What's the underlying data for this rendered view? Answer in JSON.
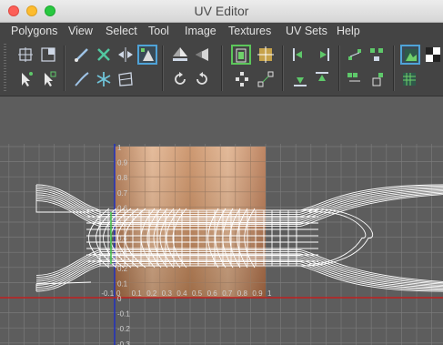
{
  "window": {
    "title": "UV Editor"
  },
  "menu": [
    "Polygons",
    "View",
    "Select",
    "Tool",
    "Image",
    "Textures",
    "UV Sets",
    "Help"
  ],
  "toolbar": {
    "row1": [
      "cut-uv-edges-icon",
      "sew-uv-edges-icon",
      "brush-icon",
      "move-sew-icon",
      "flip-icon",
      "layout-icon",
      "normalize-icon",
      "unfold-icon",
      "isolate-icon",
      "grid-snap-icon",
      "align-left-icon",
      "align-right-icon",
      "distribute-icon",
      "stack-icon",
      "texture-display-icon",
      "checker-icon"
    ],
    "row2": [
      "select-shell-icon",
      "select-border-icon",
      "smear-icon",
      "snowflake-icon",
      "relax-icon",
      "rotate-ccw-icon",
      "rotate-cw-icon",
      "pin-uv-icon",
      "distribute-uv-icon",
      "align-down-icon",
      "align-up-icon",
      "snap-together-icon",
      "shell-icon",
      "shaded-uv-icon"
    ]
  },
  "viewport": {
    "axis_labels_v": [
      "1",
      "0.9",
      "0.8",
      "0.7",
      "0.6",
      "0.5",
      "0.4",
      "0.3",
      "0.2",
      "0.1",
      "0",
      "-0.1",
      "-0.2",
      "-0.3"
    ],
    "axis_labels_u": [
      "-0.1",
      "0",
      "0.1",
      "0.2",
      "0.3",
      "0.4",
      "0.5",
      "0.6",
      "0.7",
      "0.8",
      "0.9",
      "1"
    ],
    "colors": {
      "background": "#5d5d5d",
      "grid": "#7a7a7a",
      "wire": "#ffffff",
      "u_axis": "#c02020",
      "v_axis": "#2030c0"
    }
  }
}
